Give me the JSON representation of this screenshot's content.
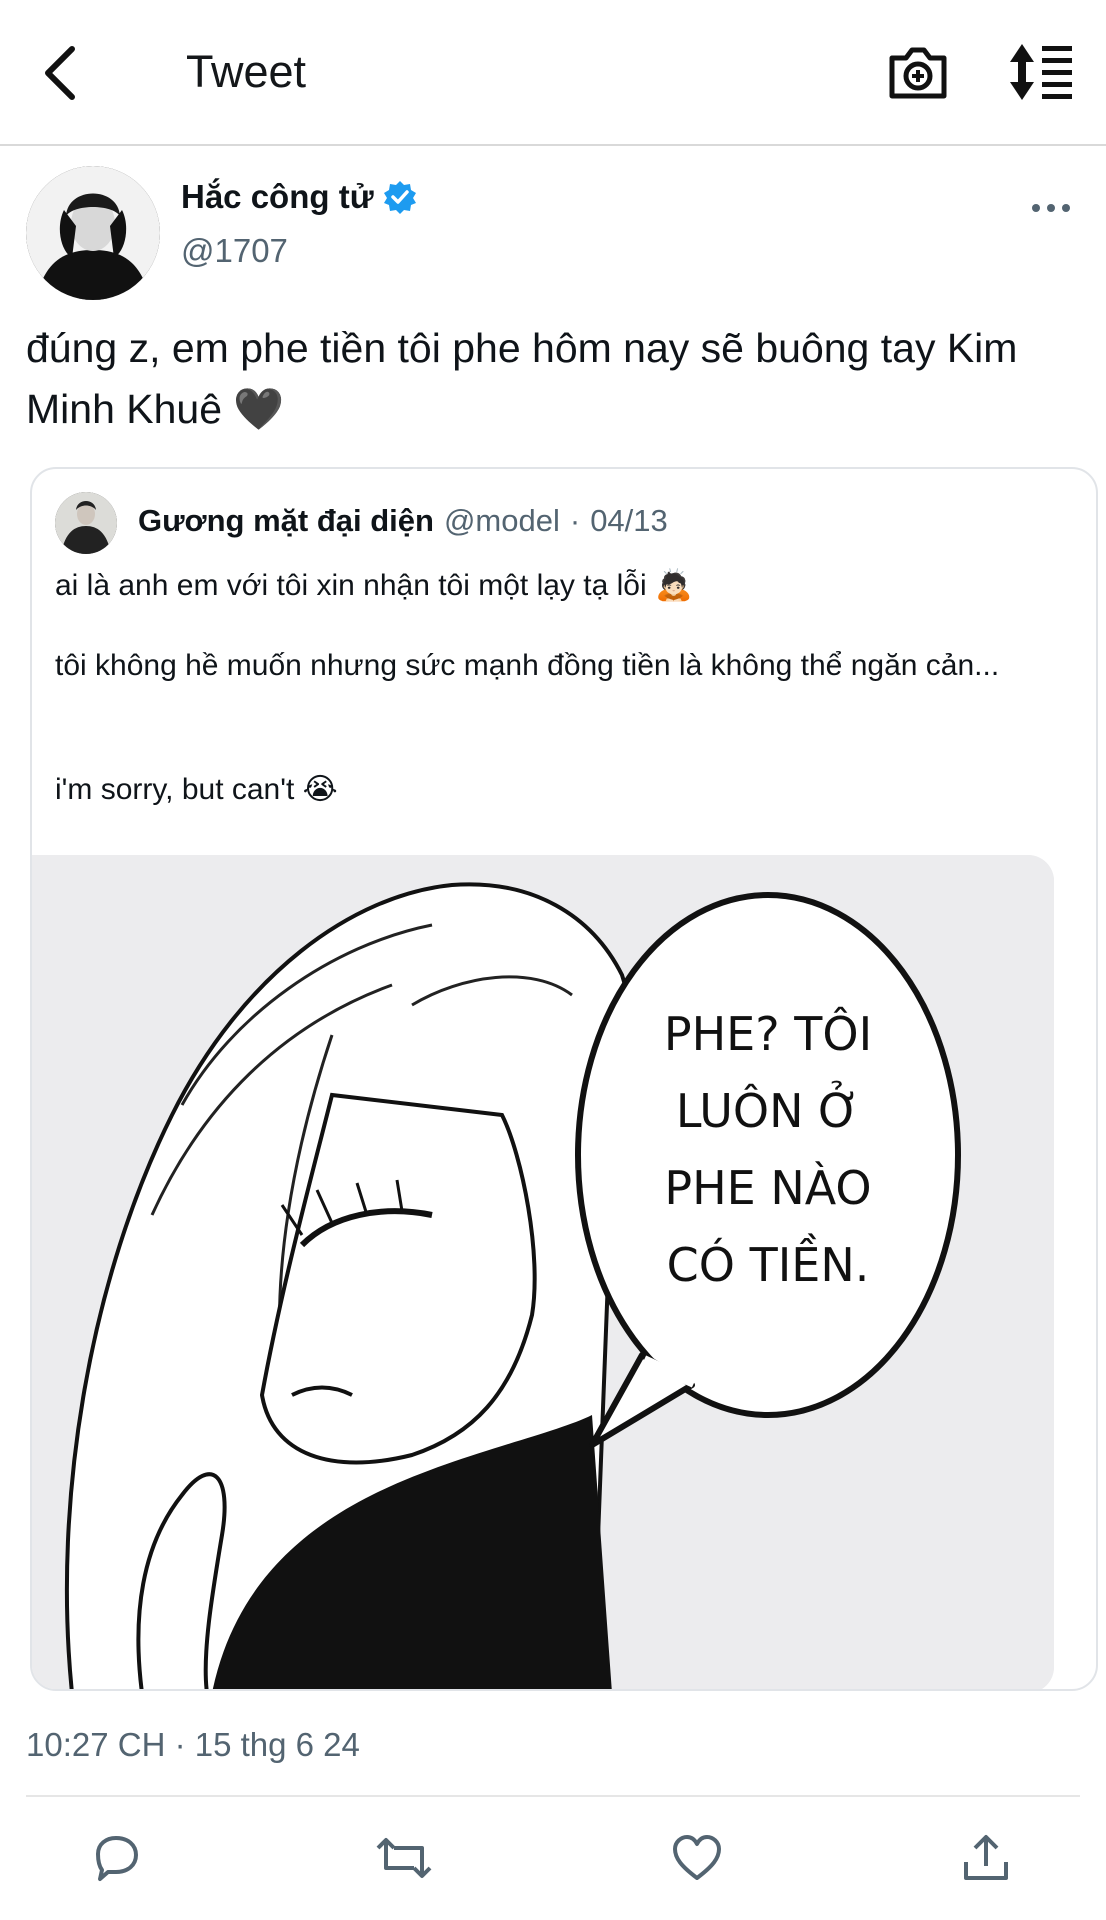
{
  "header": {
    "title": "Tweet",
    "back_icon": "chevron-left-icon",
    "camera_icon": "camera-add-icon",
    "sort_icon": "sort-icon"
  },
  "tweet": {
    "author_name": "Hắc công tử",
    "author_handle": "@1707",
    "text": "đúng z, em phe tiền tôi phe hôm nay sẽ buông tay Kim Minh Khuê 🖤",
    "timestamp": "10:27 CH · 15 thg 6 24"
  },
  "quote": {
    "author_name": "Gương mặt đại diện",
    "author_handle": "@model",
    "separator": "·",
    "date": "04/13",
    "line1": "ai là anh em với tôi xin nhận tôi một lạy tạ lỗi 🙇🏻",
    "line2": "tôi không hề muốn nhưng sức mạnh đồng tiền là không thể ngăn cản...",
    "line3": "i'm sorry, but can't 😭",
    "image_bubble": [
      "PHE? TÔI",
      "LUÔN Ở",
      "PHE NÀO",
      "CÓ TIỀN."
    ]
  },
  "actions": [
    "reply-icon",
    "retweet-icon",
    "like-icon",
    "share-icon"
  ],
  "colors": {
    "verified": "#1d9bf0",
    "secondary_text": "#536471",
    "primary_text": "#0f1419"
  }
}
